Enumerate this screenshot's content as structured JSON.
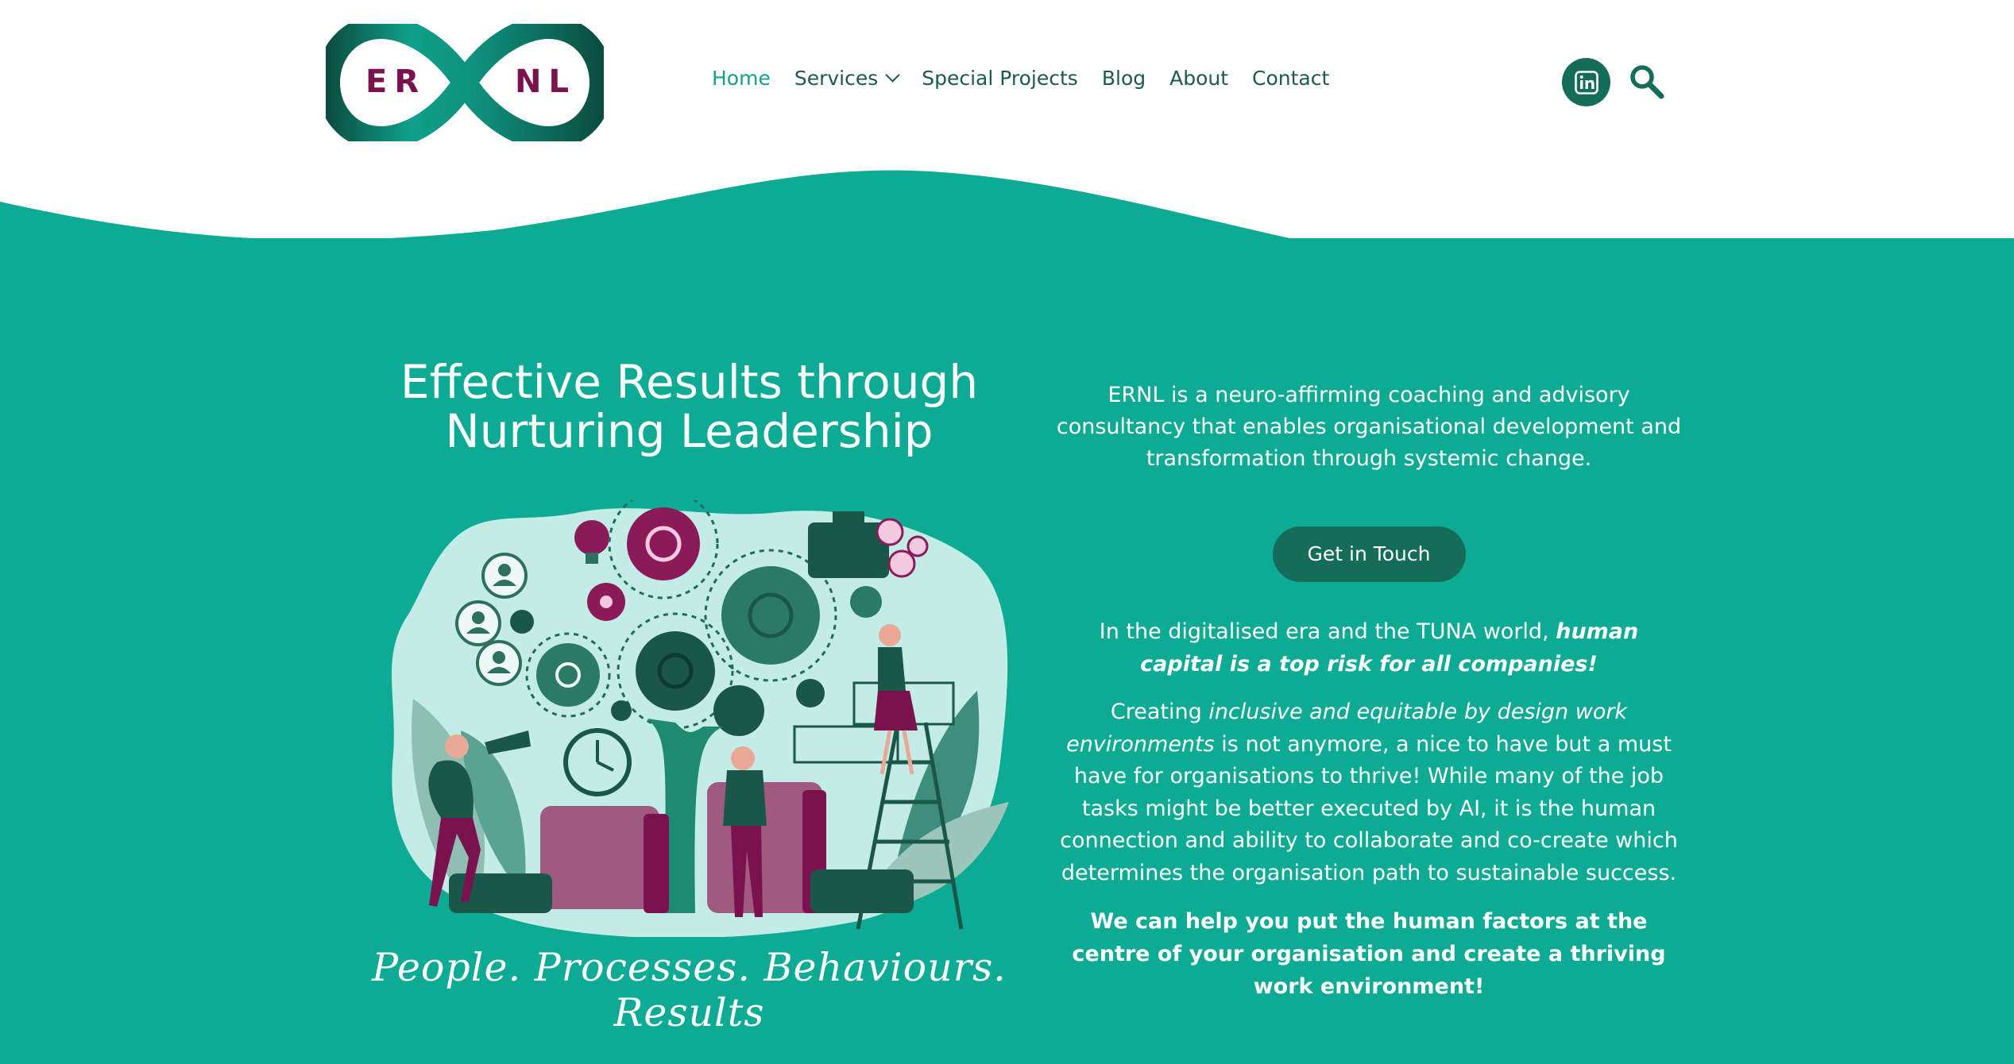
{
  "brand": {
    "logo_left": "ER",
    "logo_right": "NL",
    "colors": {
      "teal": "#0eab94",
      "dark_teal": "#166c5b",
      "magenta": "#7a1250",
      "link_active": "#13a08c"
    }
  },
  "nav": {
    "items": [
      {
        "label": "Home",
        "active": true
      },
      {
        "label": "Services",
        "has_dropdown": true
      },
      {
        "label": "Special Projects"
      },
      {
        "label": "Blog"
      },
      {
        "label": "About"
      },
      {
        "label": "Contact"
      }
    ]
  },
  "header_icons": {
    "social": "linkedin-icon",
    "search": "search-icon"
  },
  "hero": {
    "headline": "Effective Results through Nurturing Leadership",
    "tagline": "People. Processes. Behaviours. Results",
    "intro": "ERNL is a neuro-affirming coaching and advisory consultancy that enables organisational development and transformation through systemic change.",
    "cta_label": "Get in Touch",
    "p2_lead": "In the digitalised era and the TUNA  world,",
    "p2_emphasis": "human capital is a top risk for all companies!",
    "p3_lead": "Creating",
    "p3_emphasis": "inclusive and equitable by design work environments",
    "p3_rest": "is not anymore, a nice to have but a must have for organisations to thrive! While many of the job tasks might be better executed by AI, it is the human connection and ability to collaborate and co-create which determines the organisation path to sustainable success.",
    "closing": "We can help you put the human factors at the centre of your organisation and create a thriving work environment!"
  }
}
